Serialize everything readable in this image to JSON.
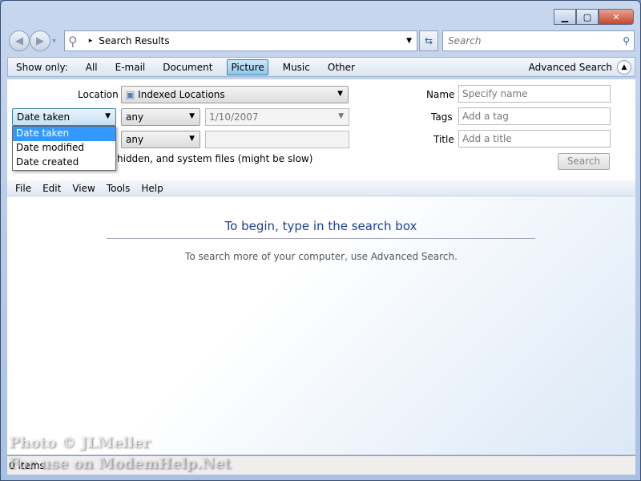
{
  "window": {
    "minimize": "▁",
    "maximize": "▢",
    "close": "✕"
  },
  "nav": {
    "back": "◀",
    "forward": "▶",
    "dropdown": "▾"
  },
  "address": {
    "arrow": "▸",
    "label": "Search Results",
    "dropdown": "▼",
    "refresh": "⇆"
  },
  "search": {
    "placeholder": "Search",
    "icon": "⚲"
  },
  "showbar": {
    "label": "Show only:",
    "items": [
      "All",
      "E-mail",
      "Document",
      "Picture",
      "Music",
      "Other"
    ],
    "selected": "Picture",
    "advanced": "Advanced Search",
    "collapse": "▲"
  },
  "pane": {
    "location_label": "Location",
    "location_value": "Indexed Locations",
    "date_field": "Date taken",
    "date_options": [
      "Date taken",
      "Date modified",
      "Date created"
    ],
    "cond1": "any",
    "date1": "1/10/2007",
    "cond2": "any",
    "date2": "",
    "hidden_text": "hidden, and system files (might be slow)",
    "name_label": "Name",
    "name_placeholder": "Specify name",
    "tags_label": "Tags",
    "tags_placeholder": "Add a tag",
    "title_label": "Title",
    "title_placeholder": "Add a title",
    "search_button": "Search"
  },
  "menu": [
    "File",
    "Edit",
    "View",
    "Tools",
    "Help"
  ],
  "content": {
    "heading": "To begin, type in the search box",
    "sub": "To search more of your computer, use Advanced Search."
  },
  "status": "0 items",
  "watermark": {
    "line1": "Photo © JLMeller",
    "line2": "For use on ModemHelp.Net"
  }
}
